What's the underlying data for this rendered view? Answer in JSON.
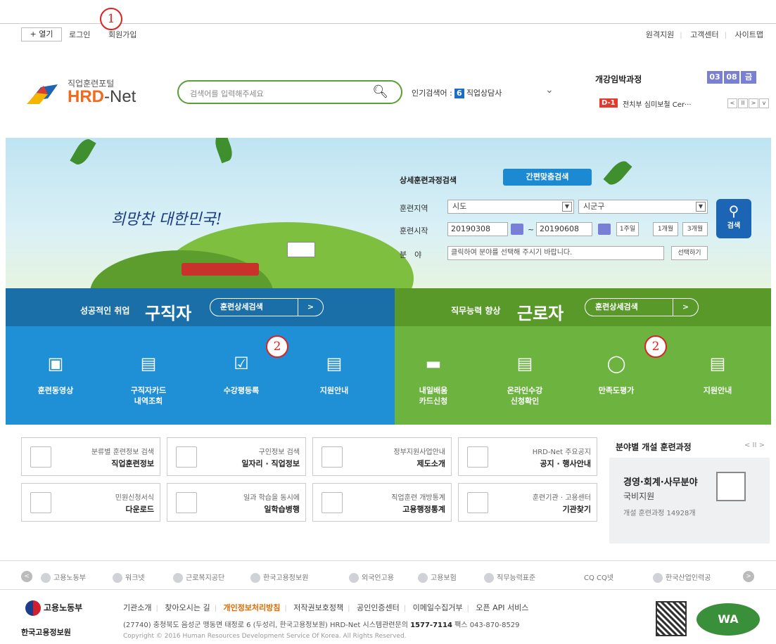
{
  "top": {
    "open": "+ 열기",
    "login": "로그인",
    "join": "회원가입",
    "marker1": "1",
    "right": [
      "원격지원",
      "고객센터",
      "사이트맵"
    ]
  },
  "header": {
    "logo_small": "직업훈련포털",
    "logo_hrd": "HRD",
    "logo_net": "-Net",
    "search_placeholder": "검색어를 입력해주세요",
    "popular_label": "인기검색어 :",
    "popular_num": "6",
    "popular_term": "직업상담사",
    "open_title": "개강임박과정",
    "date": [
      "03",
      "08",
      "금"
    ],
    "dday": "D-1",
    "ticker": "전치부 심미보철 Cer···"
  },
  "banner": {
    "slogan": "희망찬 대한민국!",
    "sf_title": "상세훈련과정검색",
    "sf_simple": "간편맞춤검색",
    "region_label": "훈련지역",
    "region_sido": "시도",
    "region_sigungu": "시군구",
    "start_label": "훈련시작",
    "start_from": "20190308",
    "tilde": "~",
    "start_to": "20190608",
    "p1": "1주일",
    "p2": "1개월",
    "p3": "3개월",
    "field_label": "분　야",
    "field_placeholder": "클릭하여 분야를 선택해 주시기 바랍니다.",
    "field_btn": "선택하기",
    "search_btn": "검색"
  },
  "panels": {
    "left": {
      "small": "성공적인 취업",
      "big": "구직자",
      "pill": "훈련상세검색",
      "arrow": ">",
      "tiles": [
        "훈련동영상",
        "구직자카드\n내역조회",
        "수강평등록",
        "지원안내"
      ]
    },
    "right": {
      "small": "직무능력 향상",
      "big": "근로자",
      "pill": "훈련상세검색",
      "arrow": ">",
      "tiles": [
        "내일배움\n카드신청",
        "온라인수강\n신청확인",
        "만족도평가",
        "지원안내"
      ]
    },
    "marker2": "2"
  },
  "info": [
    {
      "t1": "분류별 훈련정보 검색",
      "t2": "직업훈련정보"
    },
    {
      "t1": "구인정보 검색",
      "t2": "일자리 · 직업정보"
    },
    {
      "t1": "정부지원사업안내",
      "t2": "제도소개"
    },
    {
      "t1": "HRD-Net 주요공지",
      "t2": "공지 · 행사안내"
    },
    {
      "t1": "민원신청서식",
      "t2": "다운로드"
    },
    {
      "t1": "일과 학습을 동시에",
      "t2": "일학습병행"
    },
    {
      "t1": "직업훈련 개방통계",
      "t2": "고용행정통계"
    },
    {
      "t1": "훈련기관 · 고용센터",
      "t2": "기관찾기"
    }
  ],
  "field": {
    "title": "분야별 개설 훈련과정",
    "nav": "< II >",
    "name": "경영·회계·사무분야",
    "sub": "국비지원",
    "count": "개설 훈련과정 14928개"
  },
  "partners": [
    "고용노동부",
    "워크넷",
    "근로복지공단",
    "한국고용정보원",
    "외국인고용",
    "고용보험",
    "직무능력표준",
    "CQ CQ넷",
    "한국산업인력공"
  ],
  "footer": {
    "logo1": "고용노동부",
    "logo2": "한국고용정보원",
    "links": [
      "기관소개",
      "찾아오시는 길",
      "개인정보처리방침",
      "저작권보호정책",
      "공인인증센터",
      "이메일수집거부",
      "오픈 API 서비스"
    ],
    "addr": "(27740) 충청북도 음성군 맹동면 태정로 6 (두성리, 한국고용정보원) HRD-Net 시스템관련문의",
    "phone": "1577-7114",
    "fax": "팩스 043-870-8529",
    "copy": "Copyright © 2016 Human Resources Development Service Of Korea. All Rights Reserved.",
    "wa": "WA"
  }
}
